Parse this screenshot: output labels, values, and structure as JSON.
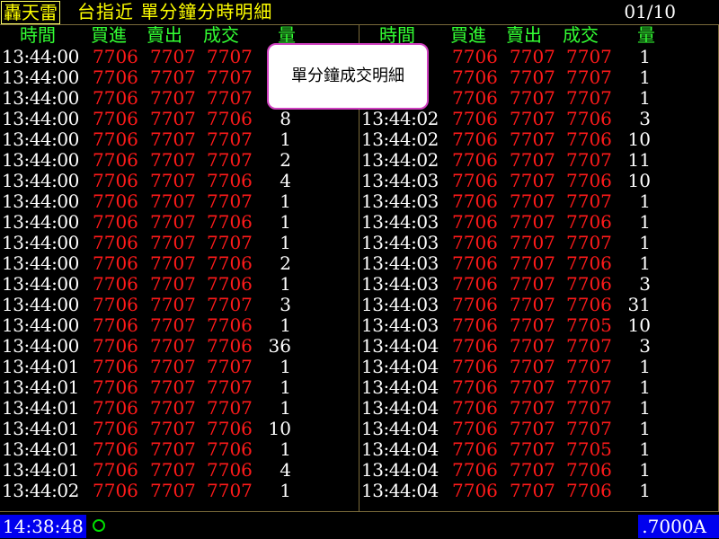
{
  "title_bar": {
    "app_name": "轟天雷",
    "title": "台指近 單分鐘分時明細",
    "page_indicator": "01/10"
  },
  "columns": {
    "time": "時間",
    "bid": "買進",
    "ask": "賣出",
    "trade": "成交",
    "qty": "量"
  },
  "tooltip": {
    "text": "單分鐘成交明細"
  },
  "left_rows": [
    {
      "time": "13:44:00",
      "bid": "7706",
      "ask": "7707",
      "trade": "7707",
      "qty": ""
    },
    {
      "time": "13:44:00",
      "bid": "7706",
      "ask": "7707",
      "trade": "7707",
      "qty": ""
    },
    {
      "time": "13:44:00",
      "bid": "7706",
      "ask": "7707",
      "trade": "7707",
      "qty": ""
    },
    {
      "time": "13:44:00",
      "bid": "7706",
      "ask": "7707",
      "trade": "7706",
      "qty": "8"
    },
    {
      "time": "13:44:00",
      "bid": "7706",
      "ask": "7707",
      "trade": "7707",
      "qty": "1"
    },
    {
      "time": "13:44:00",
      "bid": "7706",
      "ask": "7707",
      "trade": "7707",
      "qty": "2"
    },
    {
      "time": "13:44:00",
      "bid": "7706",
      "ask": "7707",
      "trade": "7706",
      "qty": "4"
    },
    {
      "time": "13:44:00",
      "bid": "7706",
      "ask": "7707",
      "trade": "7707",
      "qty": "1"
    },
    {
      "time": "13:44:00",
      "bid": "7706",
      "ask": "7707",
      "trade": "7706",
      "qty": "1"
    },
    {
      "time": "13:44:00",
      "bid": "7706",
      "ask": "7707",
      "trade": "7707",
      "qty": "1"
    },
    {
      "time": "13:44:00",
      "bid": "7706",
      "ask": "7707",
      "trade": "7706",
      "qty": "2"
    },
    {
      "time": "13:44:00",
      "bid": "7706",
      "ask": "7707",
      "trade": "7706",
      "qty": "1"
    },
    {
      "time": "13:44:00",
      "bid": "7706",
      "ask": "7707",
      "trade": "7707",
      "qty": "3"
    },
    {
      "time": "13:44:00",
      "bid": "7706",
      "ask": "7707",
      "trade": "7706",
      "qty": "1"
    },
    {
      "time": "13:44:00",
      "bid": "7706",
      "ask": "7707",
      "trade": "7706",
      "qty": "36"
    },
    {
      "time": "13:44:01",
      "bid": "7706",
      "ask": "7707",
      "trade": "7707",
      "qty": "1"
    },
    {
      "time": "13:44:01",
      "bid": "7706",
      "ask": "7707",
      "trade": "7707",
      "qty": "1"
    },
    {
      "time": "13:44:01",
      "bid": "7706",
      "ask": "7707",
      "trade": "7707",
      "qty": "1"
    },
    {
      "time": "13:44:01",
      "bid": "7706",
      "ask": "7707",
      "trade": "7706",
      "qty": "10"
    },
    {
      "time": "13:44:01",
      "bid": "7706",
      "ask": "7707",
      "trade": "7706",
      "qty": "1"
    },
    {
      "time": "13:44:01",
      "bid": "7706",
      "ask": "7707",
      "trade": "7706",
      "qty": "4"
    },
    {
      "time": "13:44:02",
      "bid": "7706",
      "ask": "7707",
      "trade": "7707",
      "qty": "1"
    }
  ],
  "right_rows": [
    {
      "time": "",
      "bid": "7706",
      "ask": "7707",
      "trade": "7707",
      "qty": "1"
    },
    {
      "time": "",
      "bid": "7706",
      "ask": "7707",
      "trade": "7707",
      "qty": "1"
    },
    {
      "time": "",
      "bid": "7706",
      "ask": "7707",
      "trade": "7707",
      "qty": "1"
    },
    {
      "time": "13:44:02",
      "bid": "7706",
      "ask": "7707",
      "trade": "7706",
      "qty": "3"
    },
    {
      "time": "13:44:02",
      "bid": "7706",
      "ask": "7707",
      "trade": "7706",
      "qty": "10"
    },
    {
      "time": "13:44:02",
      "bid": "7706",
      "ask": "7707",
      "trade": "7707",
      "qty": "11"
    },
    {
      "time": "13:44:03",
      "bid": "7706",
      "ask": "7707",
      "trade": "7706",
      "qty": "10"
    },
    {
      "time": "13:44:03",
      "bid": "7706",
      "ask": "7707",
      "trade": "7707",
      "qty": "1"
    },
    {
      "time": "13:44:03",
      "bid": "7706",
      "ask": "7707",
      "trade": "7706",
      "qty": "1"
    },
    {
      "time": "13:44:03",
      "bid": "7706",
      "ask": "7707",
      "trade": "7707",
      "qty": "1"
    },
    {
      "time": "13:44:03",
      "bid": "7706",
      "ask": "7707",
      "trade": "7706",
      "qty": "1"
    },
    {
      "time": "13:44:03",
      "bid": "7706",
      "ask": "7707",
      "trade": "7706",
      "qty": "3"
    },
    {
      "time": "13:44:03",
      "bid": "7706",
      "ask": "7707",
      "trade": "7706",
      "qty": "31"
    },
    {
      "time": "13:44:03",
      "bid": "7706",
      "ask": "7707",
      "trade": "7705",
      "qty": "10"
    },
    {
      "time": "13:44:04",
      "bid": "7706",
      "ask": "7707",
      "trade": "7707",
      "qty": "3"
    },
    {
      "time": "13:44:04",
      "bid": "7706",
      "ask": "7707",
      "trade": "7707",
      "qty": "1"
    },
    {
      "time": "13:44:04",
      "bid": "7706",
      "ask": "7707",
      "trade": "7707",
      "qty": "1"
    },
    {
      "time": "13:44:04",
      "bid": "7706",
      "ask": "7707",
      "trade": "7707",
      "qty": "1"
    },
    {
      "time": "13:44:04",
      "bid": "7706",
      "ask": "7707",
      "trade": "7707",
      "qty": "1"
    },
    {
      "time": "13:44:04",
      "bid": "7706",
      "ask": "7707",
      "trade": "7705",
      "qty": "1"
    },
    {
      "time": "13:44:04",
      "bid": "7706",
      "ask": "7707",
      "trade": "7706",
      "qty": "1"
    },
    {
      "time": "13:44:04",
      "bid": "7706",
      "ask": "7707",
      "trade": "7706",
      "qty": "1"
    }
  ],
  "status_bar": {
    "clock": "14:38:48",
    "connection_icon": "circle-icon",
    "price_readout": ".7000A"
  },
  "colors": {
    "title": "#ffff00",
    "header": "#33ff33",
    "price": "#ff1a1a",
    "status_bg": "#0000ee",
    "tooltip_border": "#d040c0"
  }
}
